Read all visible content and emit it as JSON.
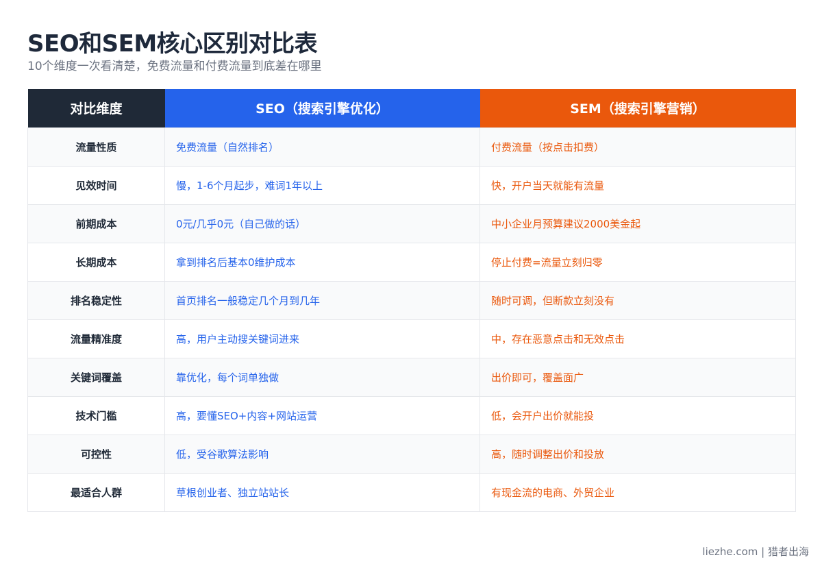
{
  "title": "SEO和SEM核心区别对比表",
  "subtitle": "10个维度一次看清楚，免费流量和付费流量到底差在哪里",
  "table": {
    "headers": {
      "dim": "对比维度",
      "seo": "SEO（搜索引擎优化）",
      "sem": "SEM（搜索引擎营销）"
    },
    "rows": [
      {
        "dim": "流量性质",
        "seo": "免费流量（自然排名）",
        "sem": "付费流量（按点击扣费）"
      },
      {
        "dim": "见效时间",
        "seo": "慢，1-6个月起步，难词1年以上",
        "sem": "快，开户当天就能有流量"
      },
      {
        "dim": "前期成本",
        "seo": "0元/几乎0元（自己做的话）",
        "sem": "中小企业月预算建议2000美金起"
      },
      {
        "dim": "长期成本",
        "seo": "拿到排名后基本0维护成本",
        "sem": "停止付费=流量立刻归零"
      },
      {
        "dim": "排名稳定性",
        "seo": "首页排名一般稳定几个月到几年",
        "sem": "随时可调，但断款立刻没有"
      },
      {
        "dim": "流量精准度",
        "seo": "高，用户主动搜关键词进来",
        "sem": "中，存在恶意点击和无效点击"
      },
      {
        "dim": "关键词覆盖",
        "seo": "靠优化，每个词单独做",
        "sem": "出价即可，覆盖面广"
      },
      {
        "dim": "技术门槛",
        "seo": "高，要懂SEO+内容+网站运营",
        "sem": "低，会开户出价就能投"
      },
      {
        "dim": "可控性",
        "seo": "低，受谷歌算法影响",
        "sem": "高，随时调整出价和投放"
      },
      {
        "dim": "最适合人群",
        "seo": "草根创业者、独立站站长",
        "sem": "有现金流的电商、外贸企业"
      }
    ]
  },
  "footer": "liezhe.com | 猎者出海",
  "colors": {
    "dark": "#1f2937",
    "seo": "#2563eb",
    "sem": "#ea580c"
  }
}
